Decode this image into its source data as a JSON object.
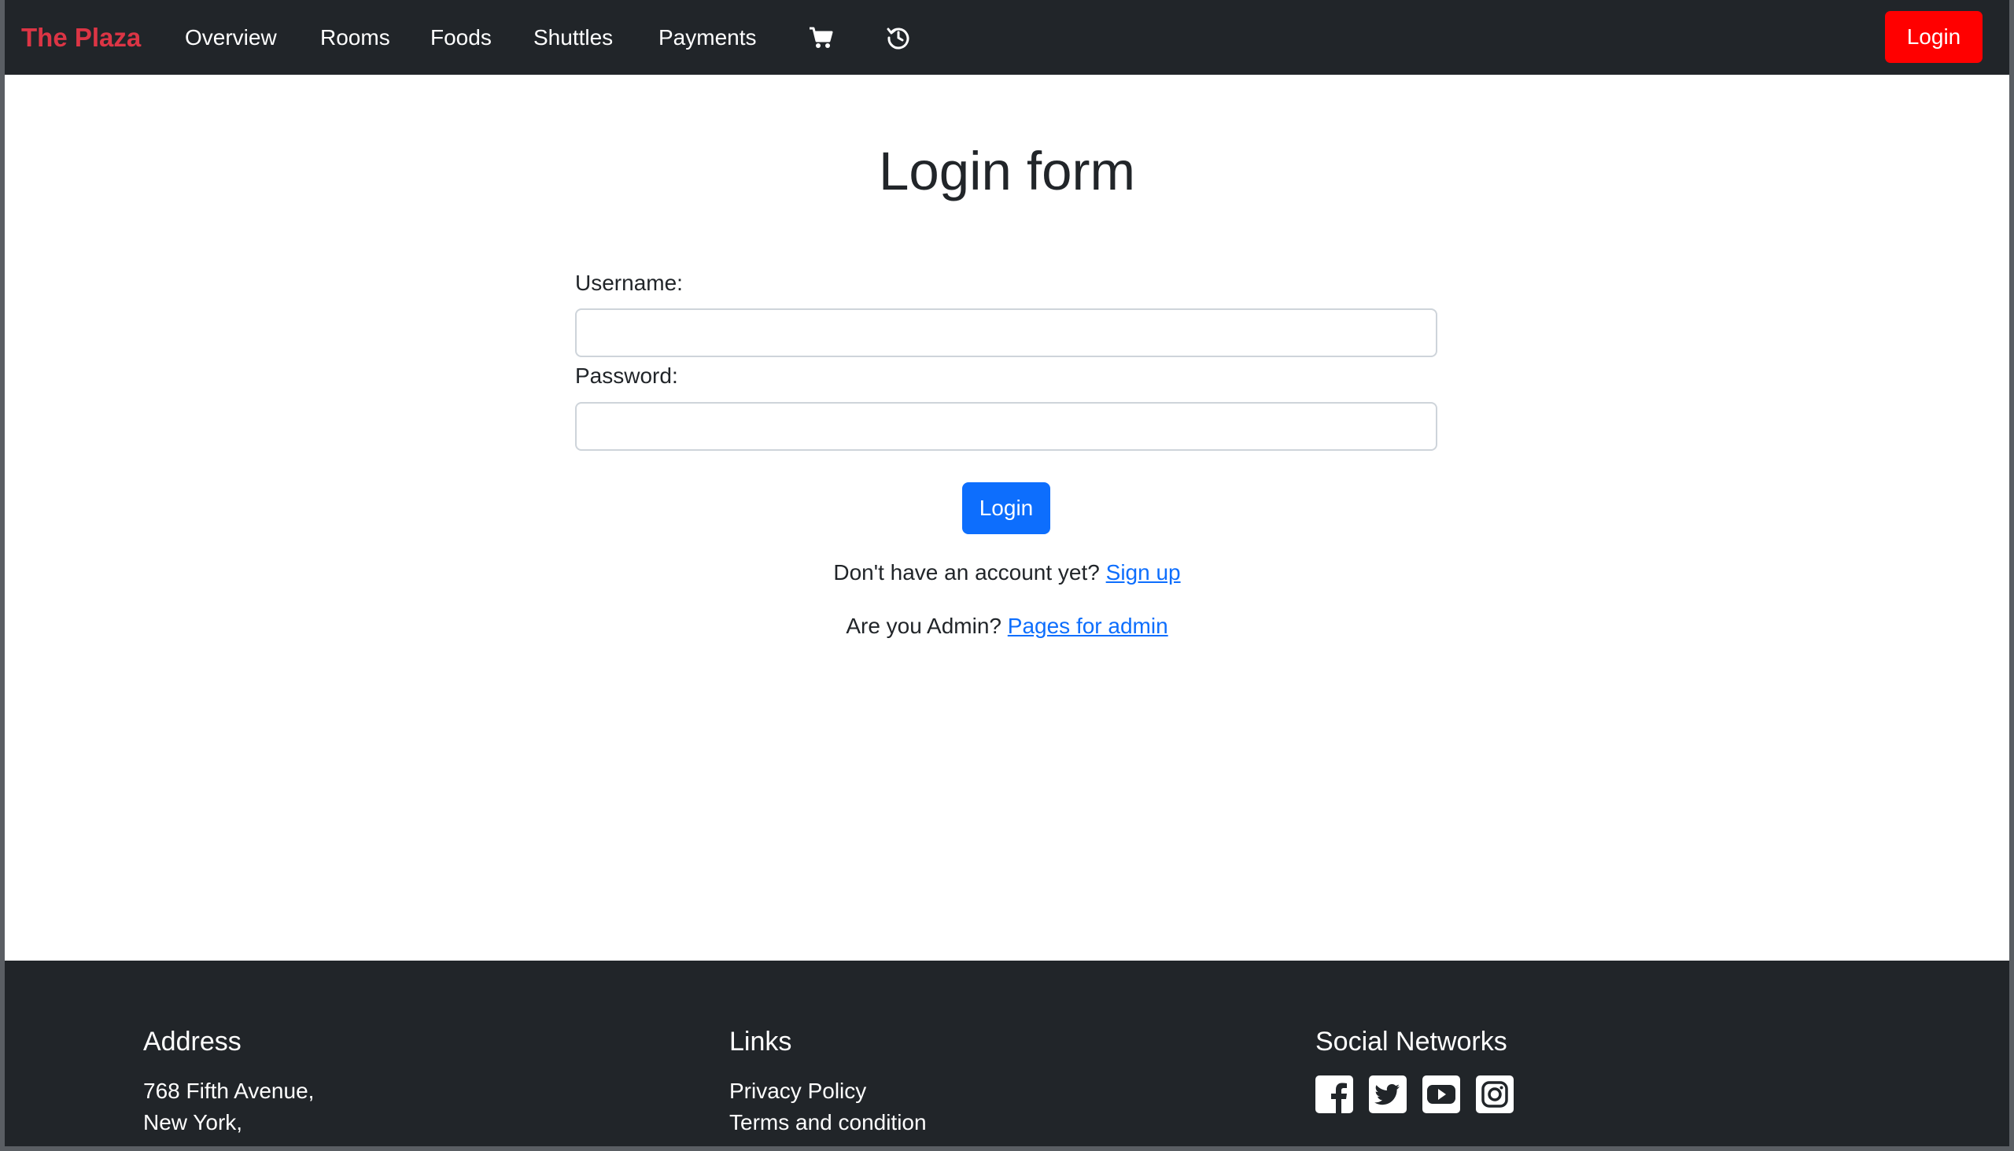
{
  "navbar": {
    "brand": "The Plaza",
    "links": [
      "Overview",
      "Rooms",
      "Foods",
      "Shuttles",
      "Payments"
    ],
    "icons": [
      "cart-icon",
      "history-icon"
    ],
    "login_label": "Login"
  },
  "main": {
    "title": "Login form",
    "username_label": "Username:",
    "username_value": "",
    "password_label": "Password:",
    "password_value": "",
    "submit_label": "Login",
    "signup_prompt": "Don't have an account yet?",
    "signup_link": "Sign up",
    "admin_prompt": "Are you Admin?",
    "admin_link": "Pages for admin"
  },
  "footer": {
    "address_heading": "Address",
    "address_lines": [
      "768 Fifth Avenue,",
      "New York,"
    ],
    "links_heading": "Links",
    "links": [
      "Privacy Policy",
      "Terms and condition"
    ],
    "social_heading": "Social Networks",
    "social_icons": [
      "facebook-icon",
      "twitter-icon",
      "youtube-icon",
      "instagram-icon"
    ]
  },
  "colors": {
    "navbar_bg": "#212529",
    "brand": "#dc3545",
    "login_red": "#ff0000",
    "primary": "#0d6efd"
  }
}
